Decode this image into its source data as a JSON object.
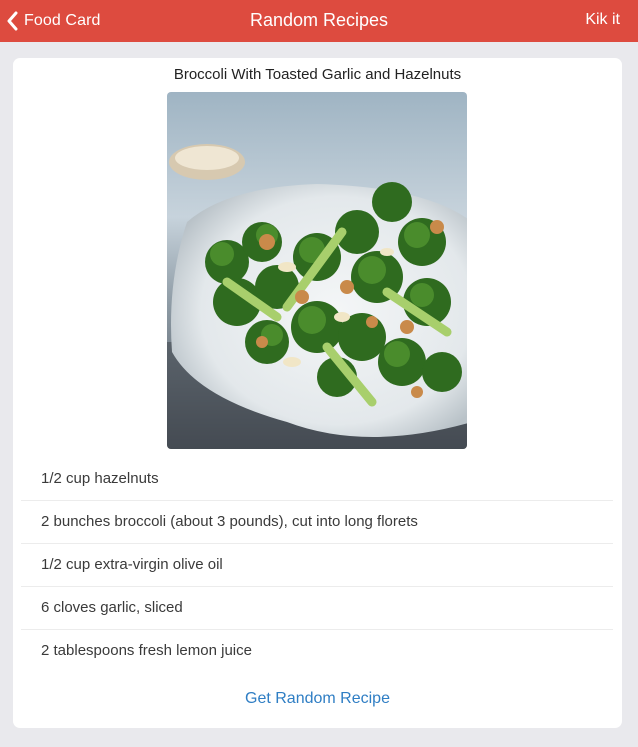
{
  "app": {
    "title": "Random Recipes",
    "accent_color": "#dd4b3f"
  },
  "nav": {
    "back_label": "Food Card",
    "back_icon": "chevron-left-icon",
    "kik_label": "Kik it"
  },
  "recipe": {
    "name": "Broccoli With Toasted Garlic and Hazelnuts",
    "ingredients": [
      "1/2 cup hazelnuts",
      "2 bunches broccoli (about 3 pounds), cut into long florets",
      "1/2 cup extra-virgin olive oil",
      "6 cloves garlic, sliced",
      "2 tablespoons fresh lemon juice"
    ]
  },
  "actions": {
    "random_label": "Get Random Recipe",
    "link_color": "#2f7ec4"
  }
}
